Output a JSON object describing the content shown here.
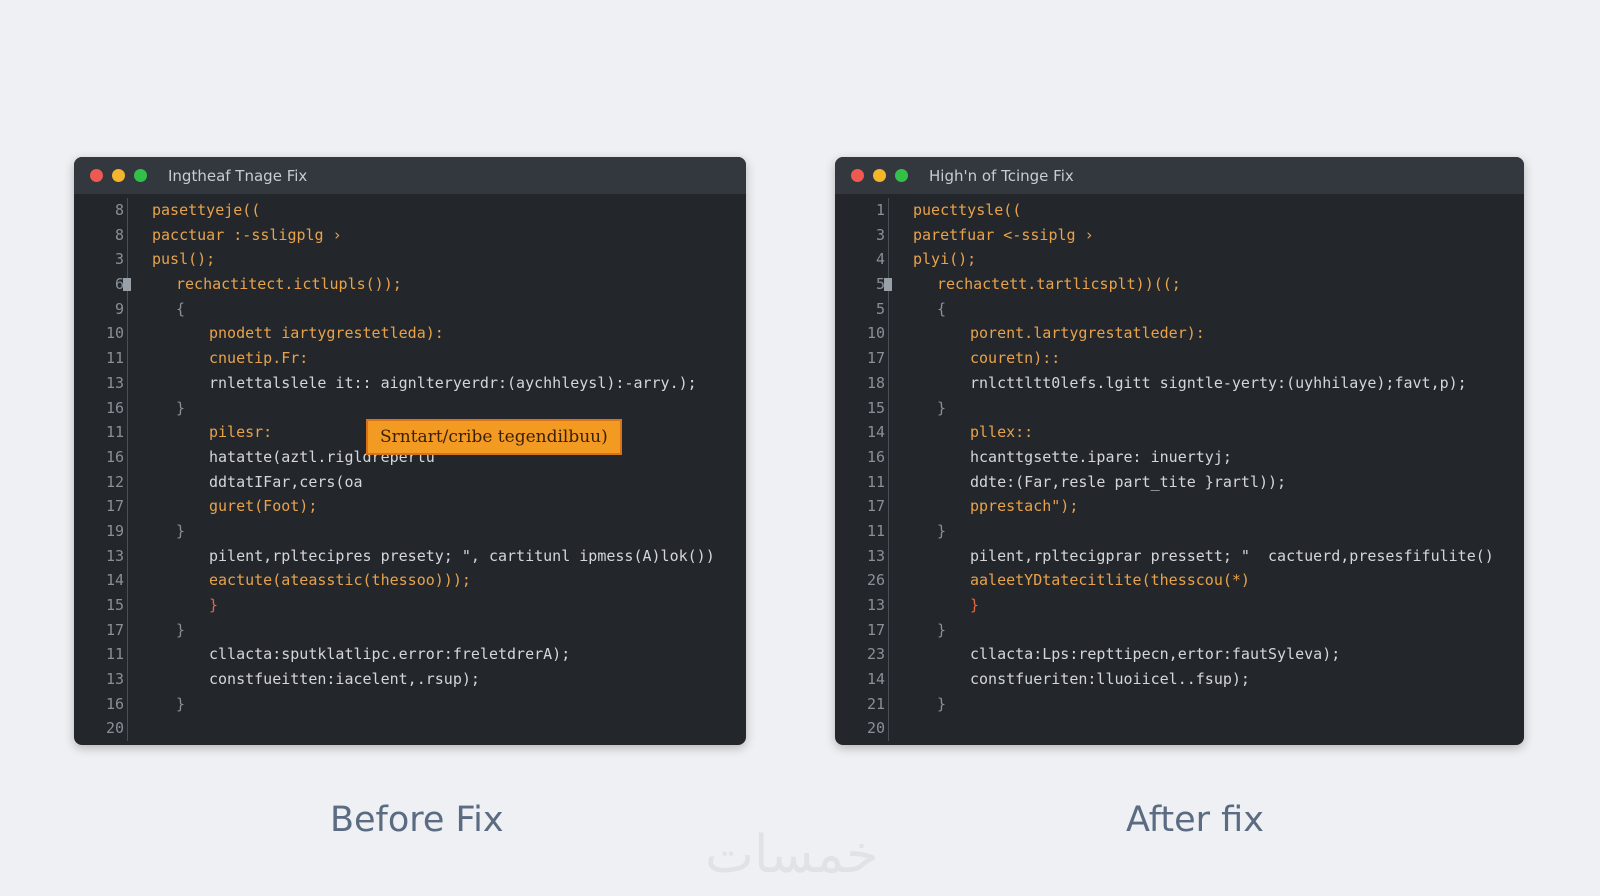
{
  "before": {
    "title": "Ingtheaf Tnage Fix",
    "caption": "Before Fix",
    "tooltip": "Srntart/cribe tegendilbuu)",
    "lines": [
      {
        "n": "8",
        "t": "pasettyeje((",
        "indent": 0
      },
      {
        "n": "8",
        "t": "pacctuar :-ssligplg ›",
        "indent": 0
      },
      {
        "n": "3",
        "t": "pusl();",
        "indent": 0
      },
      {
        "n": "6",
        "t": "rechactitect.ictlupls());",
        "indent": 1
      },
      {
        "n": "9",
        "t": "{",
        "indent": 1
      },
      {
        "n": "10",
        "t": "pnodett iartygrestetleda):",
        "indent": 2
      },
      {
        "n": "11",
        "t": "cnuetip.Fr:",
        "indent": 2
      },
      {
        "n": "13",
        "t": "rnlettalslele it:: aignlteryerdr:(aychhleysl):-arry.);",
        "indent": 2
      },
      {
        "n": "16",
        "t": "}",
        "indent": 1
      },
      {
        "n": "11",
        "t": "pilesr:",
        "indent": 2
      },
      {
        "n": "16",
        "t": "hatatte(aztl.rigldrepertu",
        "indent": 2
      },
      {
        "n": "12",
        "t": "ddtatIFar,cers(oa",
        "indent": 2
      },
      {
        "n": "17",
        "t": "guret(Foot);",
        "indent": 2
      },
      {
        "n": "19",
        "t": "}",
        "indent": 1
      },
      {
        "n": "13",
        "t": "pilent,rpltecipres presety; \", cartitunl ipmess(A)lok())",
        "indent": 2
      },
      {
        "n": "14",
        "t": "eactute(ateasstic(thessoo)));",
        "indent": 2
      },
      {
        "n": "15",
        "t": "}",
        "indent": 2
      },
      {
        "n": "17",
        "t": "}",
        "indent": 1
      },
      {
        "n": "11",
        "t": "cllacta:sputklatlipc.error:freletdrerA);",
        "indent": 2
      },
      {
        "n": "13",
        "t": "constfueitten:iacelent,.rsup);",
        "indent": 2
      },
      {
        "n": "16",
        "t": "}",
        "indent": 1
      },
      {
        "n": "20",
        "t": "",
        "indent": 0
      }
    ]
  },
  "after": {
    "title": "High'n of Tcinge Fix",
    "caption": "After fix",
    "lines": [
      {
        "n": "1",
        "t": "puecttysle((",
        "indent": 0
      },
      {
        "n": "3",
        "t": "paretfuar <-ssiplg ›",
        "indent": 0
      },
      {
        "n": "4",
        "t": "plyi();",
        "indent": 0
      },
      {
        "n": "5",
        "t": "rechactett.tartlicsplt))((;",
        "indent": 1
      },
      {
        "n": "5",
        "t": "{",
        "indent": 1
      },
      {
        "n": "10",
        "t": "porent.lartygrestatleder):",
        "indent": 2
      },
      {
        "n": "17",
        "t": "couretn)::",
        "indent": 2
      },
      {
        "n": "18",
        "t": "rnlcttltt0lefs.lgitt signtle-yerty:(uyhhilaye);favt,p);",
        "indent": 2
      },
      {
        "n": "15",
        "t": "}",
        "indent": 1
      },
      {
        "n": "14",
        "t": "pllex::",
        "indent": 2
      },
      {
        "n": "16",
        "t": "hcanttgsette.ipare: inuertyj;",
        "indent": 2
      },
      {
        "n": "11",
        "t": "ddte:(Far,resle part_tite }rartl));",
        "indent": 2
      },
      {
        "n": "17",
        "t": "pprestach\");",
        "indent": 2
      },
      {
        "n": "11",
        "t": "}",
        "indent": 1
      },
      {
        "n": "13",
        "t": "pilent,rpltecigprar pressett; \"  cactuerd,presesfifulite()",
        "indent": 2
      },
      {
        "n": "26",
        "t": "aaleetYDtatecitlite(thesscou(*)",
        "indent": 2
      },
      {
        "n": "13",
        "t": "}",
        "indent": 2
      },
      {
        "n": "17",
        "t": "}",
        "indent": 1
      },
      {
        "n": "23",
        "t": "cllacta:Lps:repttipecn,ertor:fautSyleva);",
        "indent": 2
      },
      {
        "n": "14",
        "t": "constfueriten:lluoiicel..fsup);",
        "indent": 2
      },
      {
        "n": "21",
        "t": "}",
        "indent": 1
      },
      {
        "n": "20",
        "t": "",
        "indent": 0
      }
    ]
  },
  "watermark": "خمسات",
  "colors": {
    "background": "#eef0f3",
    "editor": "#23272c",
    "titlebar": "#33383e",
    "tooltip": "#f39a22",
    "caption": "#5b6b82"
  }
}
